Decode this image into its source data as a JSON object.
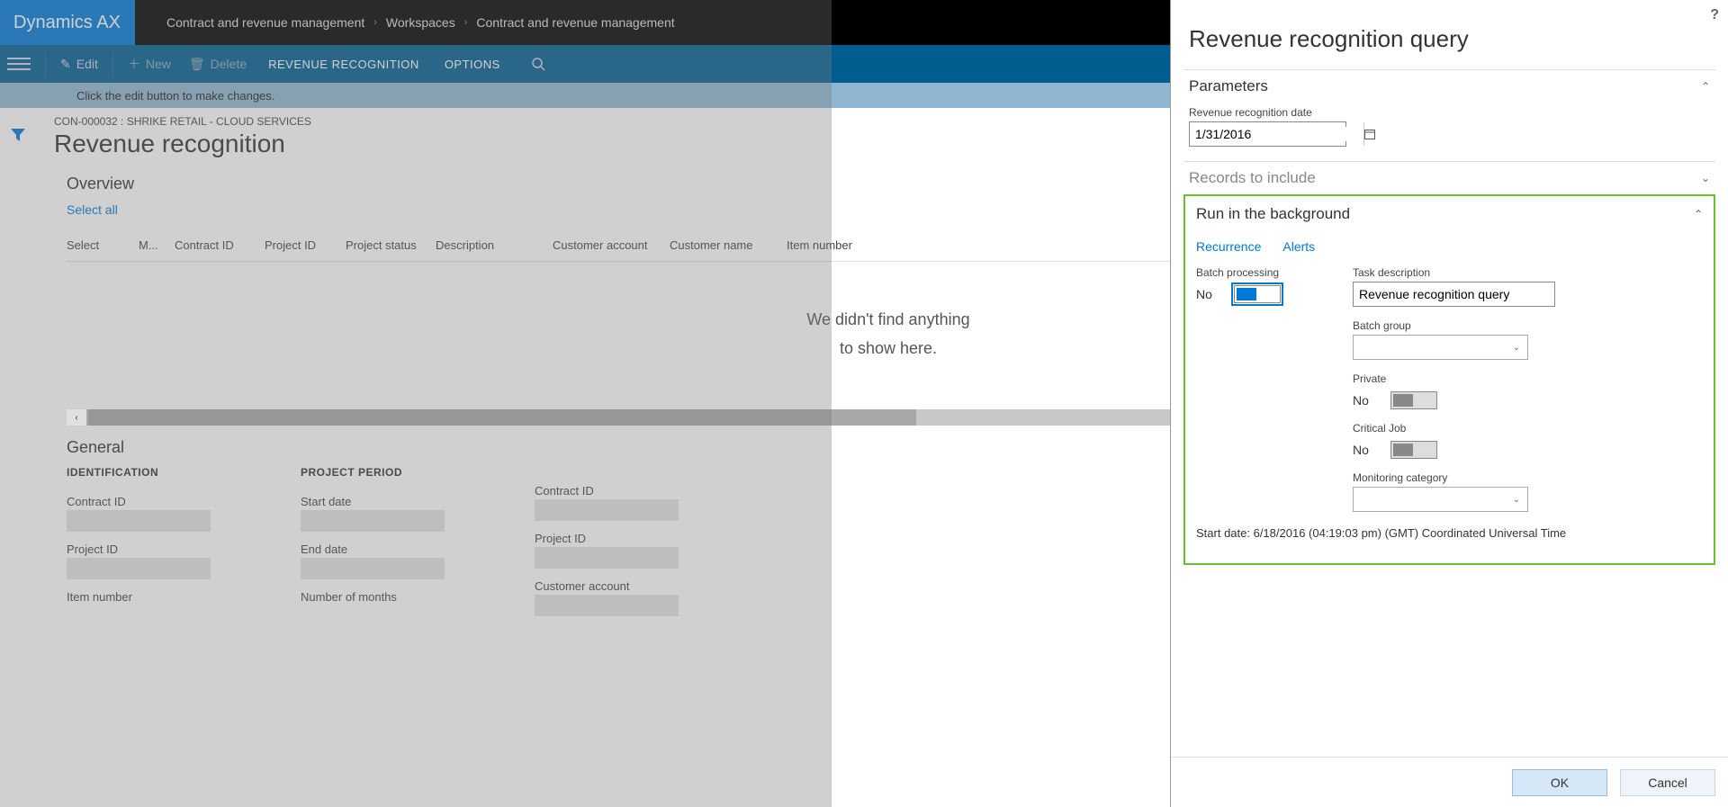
{
  "brand": "Dynamics AX",
  "breadcrumb": {
    "item1": "Contract and revenue management",
    "item2": "Workspaces",
    "item3": "Contract and revenue management"
  },
  "actionbar": {
    "edit": "Edit",
    "new": "New",
    "delete": "Delete",
    "tab1": "REVENUE RECOGNITION",
    "tab2": "OPTIONS"
  },
  "infobar": "Click the edit button to make changes.",
  "record": {
    "title": "CON-000032 : SHRIKE RETAIL - CLOUD SERVICES",
    "page_title": "Revenue recognition"
  },
  "overview": {
    "title": "Overview",
    "select_all": "Select all",
    "cols": {
      "select": "Select",
      "m": "M...",
      "contract": "Contract ID",
      "project": "Project ID",
      "pstatus": "Project status",
      "desc": "Description",
      "caccount": "Customer account",
      "cname": "Customer name",
      "item": "Item number"
    },
    "empty_line1": "We didn't find anything",
    "empty_line2": "to show here."
  },
  "general": {
    "title": "General",
    "group1": "IDENTIFICATION",
    "group2": "PROJECT PERIOD",
    "labels": {
      "contract_id": "Contract ID",
      "project_id": "Project ID",
      "item_number": "Item number",
      "start_date": "Start date",
      "end_date": "End date",
      "num_months": "Number of months",
      "contract_id2": "Contract ID",
      "project_id2": "Project ID",
      "cust_account": "Customer account"
    }
  },
  "panel": {
    "title": "Revenue recognition query",
    "parameters": {
      "title": "Parameters",
      "date_label": "Revenue recognition date",
      "date_value": "1/31/2016"
    },
    "records": {
      "title": "Records to include"
    },
    "background": {
      "title": "Run in the background",
      "recurrence": "Recurrence",
      "alerts": "Alerts",
      "batch_label": "Batch processing",
      "batch_value": "No",
      "task_label": "Task description",
      "task_value": "Revenue recognition query",
      "batch_group_label": "Batch group",
      "private_label": "Private",
      "private_value": "No",
      "critical_label": "Critical Job",
      "critical_value": "No",
      "monitoring_label": "Monitoring category",
      "start_date": "Start date: 6/18/2016 (04:19:03 pm) (GMT) Coordinated Universal Time"
    },
    "buttons": {
      "ok": "OK",
      "cancel": "Cancel"
    }
  }
}
